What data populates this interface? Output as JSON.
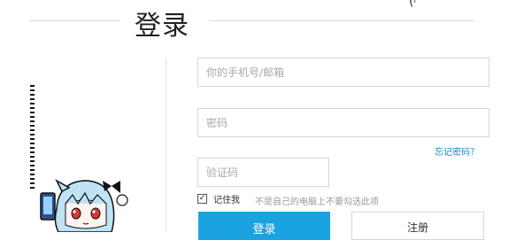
{
  "header": {
    "title": "登录",
    "corner_mark": "(ʲʽʼ"
  },
  "form": {
    "phone_placeholder": "你的手机号/邮箱",
    "password_placeholder": "密码",
    "forgot_label": "忘记密码？",
    "captcha_placeholder": "验证码",
    "remember_label": "记住我",
    "remember_checked": true,
    "hint": "不是自己的电脑上不要勾选此项",
    "login_label": "登录",
    "register_label": "注册"
  },
  "colors": {
    "primary": "#1aa3e0",
    "link": "#1a85c6",
    "border": "#d6d6d6"
  },
  "icons": {
    "mascot": "anime-mascot-icon",
    "check": "checkmark-icon"
  }
}
